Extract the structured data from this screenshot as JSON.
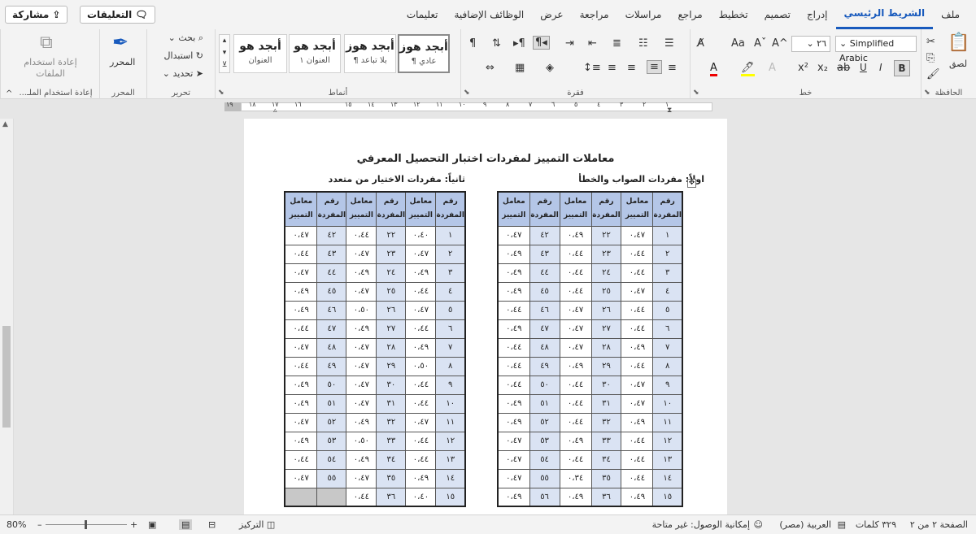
{
  "tabs": [
    "ملف",
    "الشريط الرئيسي",
    "إدراج",
    "تصميم",
    "تخطيط",
    "مراجع",
    "مراسلات",
    "مراجعة",
    "عرض",
    "الوظائف الإضافية",
    "تعليمات"
  ],
  "share_label": "مشاركة",
  "comments_label": "التعليقات",
  "ribbon": {
    "clipboard": {
      "label": "الحافظة",
      "paste": "لصق"
    },
    "font": {
      "label": "خط",
      "name": "Simplified Arabic",
      "size": "٢٦",
      "bold": "B",
      "italic": "I",
      "underline": "U"
    },
    "paragraph": {
      "label": "فقرة"
    },
    "styles": {
      "label": "أنماط",
      "items": [
        {
          "preview": "أبجد هوز",
          "name": "¶ عادي"
        },
        {
          "preview": "أبجد هوز",
          "name": "¶ بلا تباعد"
        },
        {
          "preview": "أبجد هو",
          "name": "العنوان ١"
        },
        {
          "preview": "أبجد هو",
          "name": "العنوان"
        }
      ]
    },
    "editing": {
      "label": "تحرير",
      "find": "بحث",
      "replace": "استبدال",
      "select": "تحديد"
    },
    "editor": {
      "label": "المحرر",
      "button": "المحرر"
    },
    "reuse": {
      "label": "إعادة استخدام الملـ...",
      "button_line1": "إعادة استخدام",
      "button_line2": "الملفات"
    }
  },
  "ruler_ticks": [
    "١",
    "٢",
    "٣",
    "٤",
    "٥",
    "٦",
    "٧",
    "٨",
    "٩",
    "١٠",
    "١١",
    "١٢",
    "١٣",
    "١٤",
    "١٥",
    "١٦",
    "١٧",
    "١٨",
    "١٩"
  ],
  "document": {
    "title": "معاملات التمييز لمفردات اختبار التحصيل المعرفي",
    "section1": "اولاً: مفردات الصواب والخطأ",
    "section2": "ثانياً: مفردات الاختيار من متعدد",
    "headers": [
      "رقم المفردة",
      "معامل التمييز",
      "رقم المفردة",
      "معامل التمييز",
      "رقم المفردة",
      "معامل التمييز"
    ],
    "table1": [
      [
        "١",
        "٠،٤٧",
        "٢٢",
        "٠،٤٩",
        "٤٢",
        "٠،٤٧"
      ],
      [
        "٢",
        "٠،٤٤",
        "٢٣",
        "٠،٤٤",
        "٤٣",
        "٠،٤٩"
      ],
      [
        "٣",
        "٠،٤٤",
        "٢٤",
        "٠،٤٤",
        "٤٤",
        "٠،٤٩"
      ],
      [
        "٤",
        "٠،٤٧",
        "٢٥",
        "٠،٤٤",
        "٤٥",
        "٠،٤٩"
      ],
      [
        "٥",
        "٠،٤٤",
        "٢٦",
        "٠،٤٧",
        "٤٦",
        "٠،٤٤"
      ],
      [
        "٦",
        "٠،٤٤",
        "٢٧",
        "٠،٤٧",
        "٤٧",
        "٠،٤٩"
      ],
      [
        "٧",
        "٠،٤٩",
        "٢٨",
        "٠،٤٧",
        "٤٨",
        "٠،٤٤"
      ],
      [
        "٨",
        "٠،٤٤",
        "٢٩",
        "٠،٤٩",
        "٤٩",
        "٠،٤٤"
      ],
      [
        "٩",
        "٠،٤٧",
        "٣٠",
        "٠،٤٤",
        "٥٠",
        "٠،٤٤"
      ],
      [
        "١٠",
        "٠،٤٧",
        "٣١",
        "٠،٤٤",
        "٥١",
        "٠،٤٩"
      ],
      [
        "١١",
        "٠،٤٩",
        "٣٢",
        "٠،٤٤",
        "٥٢",
        "٠،٤٩"
      ],
      [
        "١٢",
        "٠،٤٤",
        "٣٣",
        "٠،٤٩",
        "٥٣",
        "٠،٤٧"
      ],
      [
        "١٣",
        "٠،٤٤",
        "٣٤",
        "٠،٤٤",
        "٥٤",
        "٠،٤٧"
      ],
      [
        "١٤",
        "٠،٤٤",
        "٣٥",
        "٠،٣٤",
        "٥٥",
        "٠،٤٧"
      ],
      [
        "١٥",
        "٠،٤٩",
        "٣٦",
        "٠،٤٩",
        "٥٦",
        "٠،٤٩"
      ]
    ],
    "table2": [
      [
        "١",
        "٠،٤٠",
        "٢٢",
        "٠،٤٤",
        "٤٢",
        "٠،٤٧"
      ],
      [
        "٢",
        "٠،٤٧",
        "٢٣",
        "٠،٤٧",
        "٤٣",
        "٠،٤٤"
      ],
      [
        "٣",
        "٠،٤٩",
        "٢٤",
        "٠،٤٩",
        "٤٤",
        "٠،٤٧"
      ],
      [
        "٤",
        "٠،٤٤",
        "٢٥",
        "٠،٤٧",
        "٤٥",
        "٠،٤٩"
      ],
      [
        "٥",
        "٠،٤٧",
        "٢٦",
        "٠،٥٠",
        "٤٦",
        "٠،٤٩"
      ],
      [
        "٦",
        "٠،٤٤",
        "٢٧",
        "٠،٤٩",
        "٤٧",
        "٠،٤٤"
      ],
      [
        "٧",
        "٠،٤٩",
        "٢٨",
        "٠،٤٧",
        "٤٨",
        "٠،٤٧"
      ],
      [
        "٨",
        "٠،٥٠",
        "٢٩",
        "٠،٤٧",
        "٤٩",
        "٠،٤٤"
      ],
      [
        "٩",
        "٠،٤٤",
        "٣٠",
        "٠،٤٧",
        "٥٠",
        "٠،٤٩"
      ],
      [
        "١٠",
        "٠،٤٤",
        "٣١",
        "٠،٤٧",
        "٥١",
        "٠،٤٩"
      ],
      [
        "١١",
        "٠،٤٧",
        "٣٢",
        "٠،٤٩",
        "٥٢",
        "٠،٤٧"
      ],
      [
        "١٢",
        "٠،٤٤",
        "٣٣",
        "٠،٥٠",
        "٥٣",
        "٠،٤٩"
      ],
      [
        "١٣",
        "٠،٤٤",
        "٣٤",
        "٠،٤٩",
        "٥٤",
        "٠،٤٤"
      ],
      [
        "١٤",
        "٠،٤٩",
        "٣٥",
        "٠،٤٧",
        "٥٥",
        "٠،٤٧"
      ],
      [
        "١٥",
        "٠،٤٠",
        "٣٦",
        "٠،٤٤",
        "",
        ""
      ]
    ]
  },
  "status": {
    "page": "الصفحة ٢ من ٢",
    "words": "٣٢٩ كلمات",
    "language": "العربية (مصر)",
    "accessibility": "إمكانية الوصول: غير متاحة",
    "focus": "التركيز",
    "zoom": "80%"
  },
  "colors": {
    "accent": "#185abd",
    "header_fill": "#b4c6e7",
    "number_fill": "#dae3f3"
  }
}
